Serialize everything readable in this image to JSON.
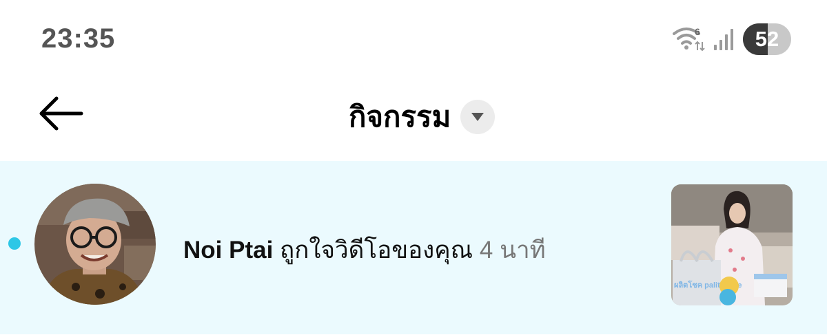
{
  "status_bar": {
    "time": "23:35",
    "wifi_badge": "6",
    "battery_level": "52",
    "icons": [
      "wifi-icon",
      "cellular-signal-icon",
      "battery-icon"
    ]
  },
  "header": {
    "title": "กิจกรรม",
    "back_icon": "arrow-left-icon",
    "dropdown_icon": "caret-down-icon"
  },
  "notifications": [
    {
      "user_name": "Noi Ptai",
      "action": "ถูกใจวิดีโอของคุณ",
      "time_ago": "4 นาที",
      "unread": true,
      "thumbnail_text": "ผลิตโชค palitchoke"
    }
  ],
  "colors": {
    "unread_row_bg": "#ebfafe",
    "unread_dot": "#2ec7e6",
    "time_text": "#777777"
  }
}
